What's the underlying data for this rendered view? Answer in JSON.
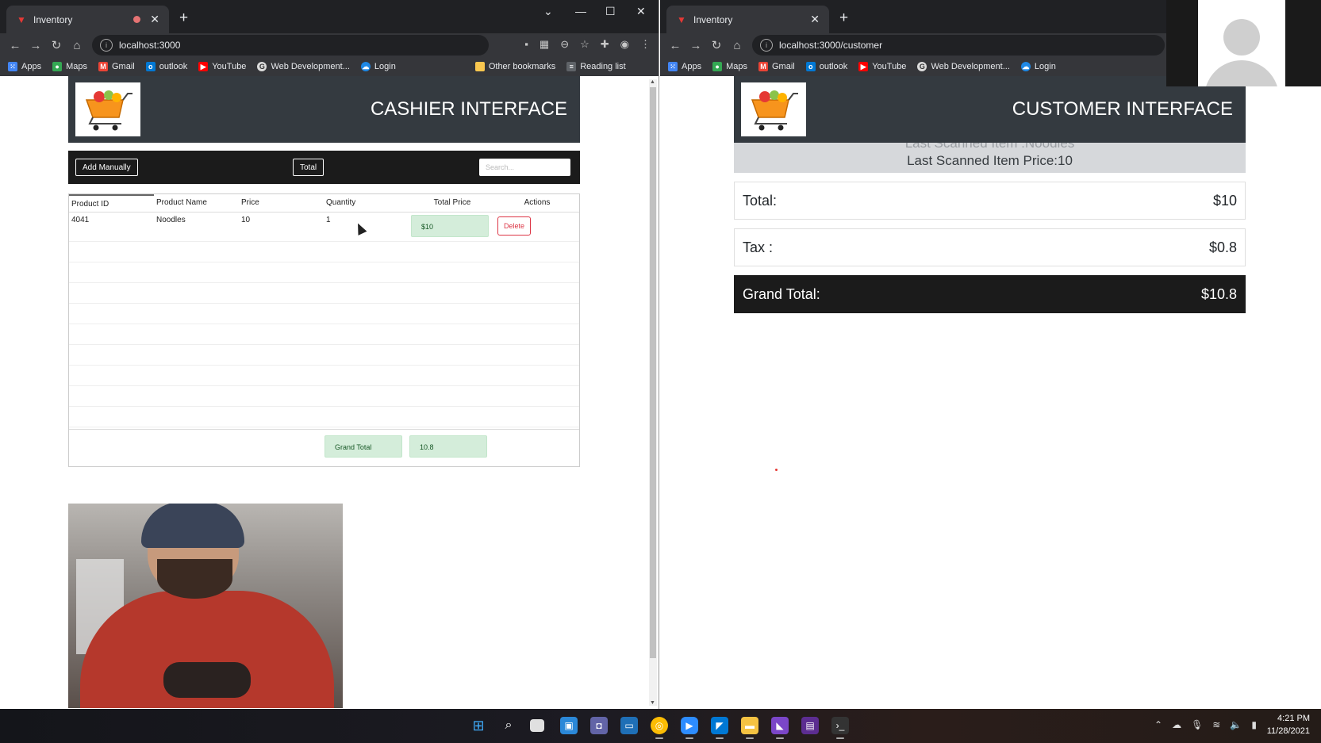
{
  "left_window": {
    "tab_title": "Inventory",
    "url": "localhost:3000",
    "bookmarks": [
      "Apps",
      "Maps",
      "Gmail",
      "outlook",
      "YouTube",
      "Web Development...",
      "Login"
    ],
    "other_bookmarks": "Other bookmarks",
    "reading_list": "Reading list",
    "header_title": "CASHIER INTERFACE",
    "add_manually": "Add Manually",
    "total_button": "Total",
    "search_placeholder": "Search...",
    "columns": [
      "Product ID",
      "Product Name",
      "Price",
      "Quantity",
      "Total Price",
      "Actions"
    ],
    "rows": [
      {
        "id": "4041",
        "name": "Noodles",
        "price": "10",
        "quantity": "1",
        "total": "$10",
        "action": "Delete"
      }
    ],
    "grand_total_label": "Grand Total",
    "grand_total_value": "10.8"
  },
  "right_window": {
    "tab_title": "Inventory",
    "url": "localhost:3000/customer",
    "bookmarks": [
      "Apps",
      "Maps",
      "Gmail",
      "outlook",
      "YouTube",
      "Web Development...",
      "Login"
    ],
    "header_title": "CUSTOMER INTERFACE",
    "last_item_name": "Last Scanned Item :Noodles",
    "last_item_price": "Last Scanned Item Price:10",
    "total_label": "Total:",
    "total_value": "$10",
    "tax_label": "Tax :",
    "tax_value": "$0.8",
    "grand_total_label": "Grand Total:",
    "grand_total_value": "$10.8"
  },
  "taskbar": {
    "time": "4:21 PM",
    "date": "11/28/2021"
  }
}
